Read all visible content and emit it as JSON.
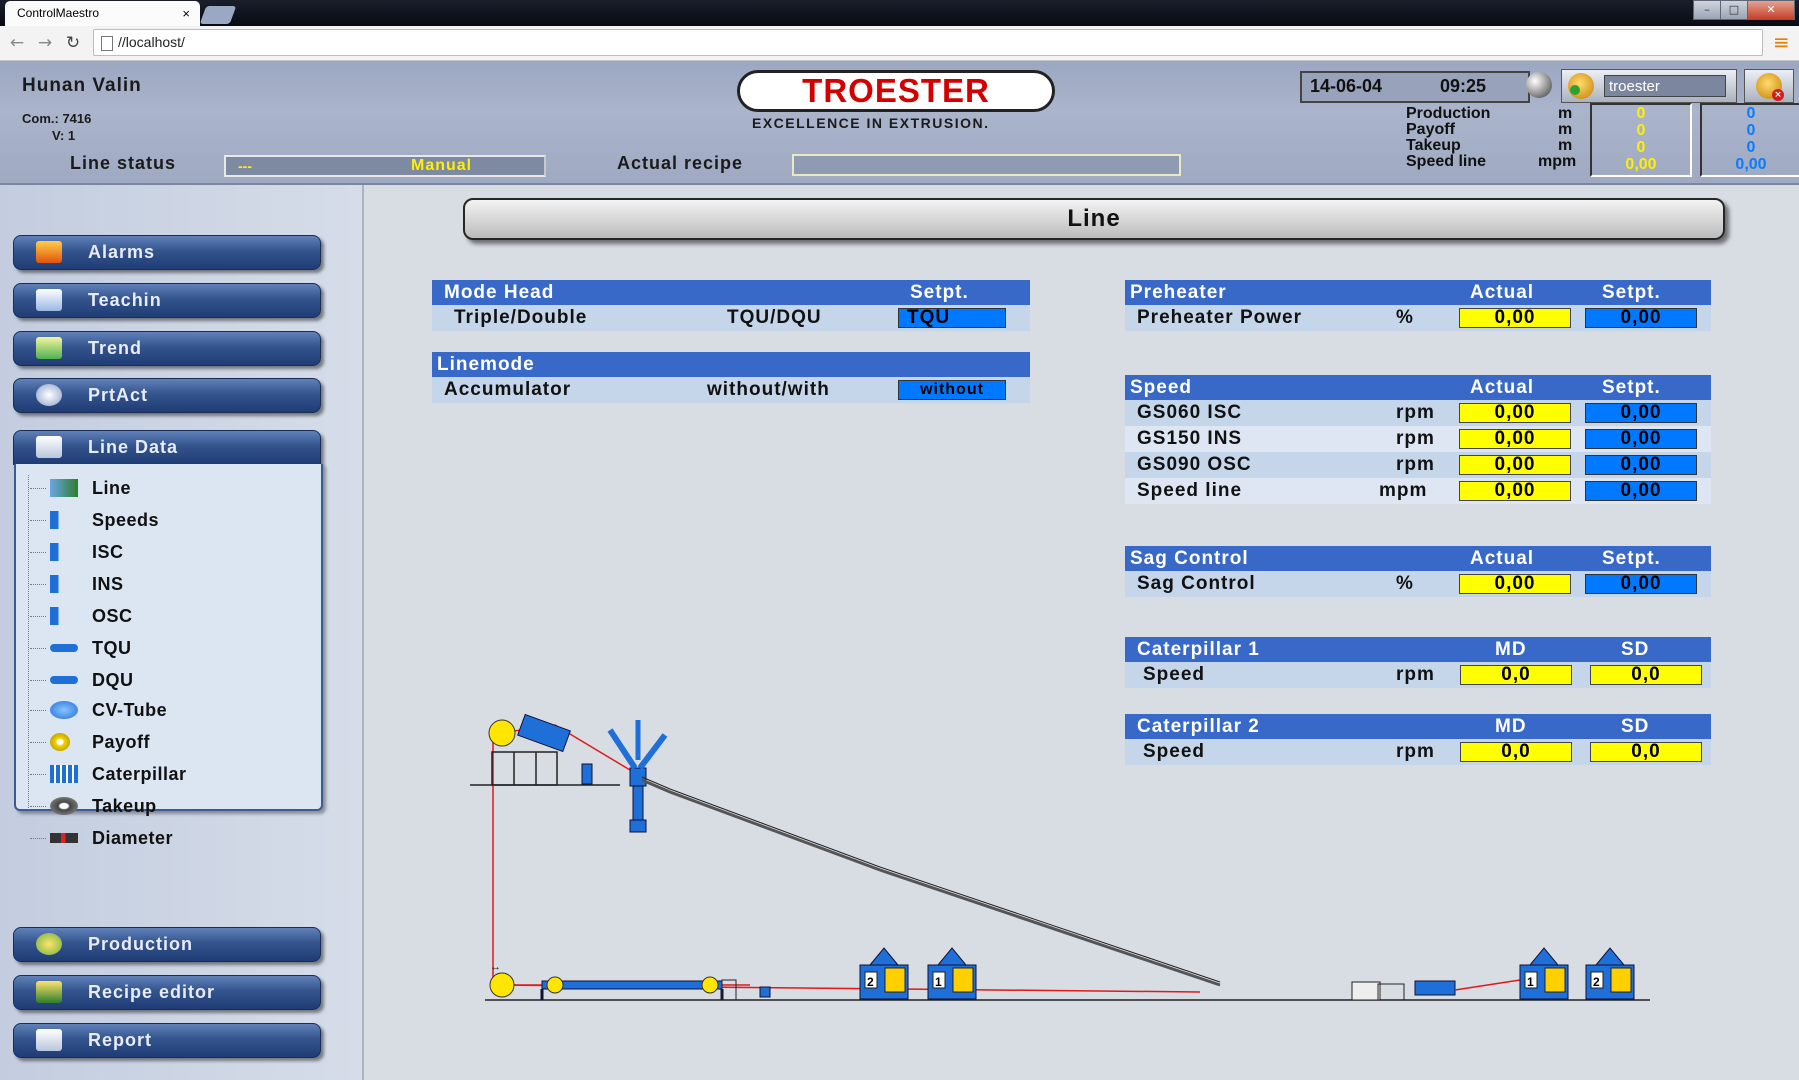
{
  "browser": {
    "tab_title": "ControlMaestro",
    "tab_close": "×",
    "url": "//localhost/"
  },
  "header": {
    "company": "Hunan Valin",
    "com": "Com.: 7416",
    "version": "V: 1",
    "line_status_label": "Line status",
    "line_status_dash": "---",
    "line_status_value": "Manual",
    "actual_recipe_label": "Actual recipe",
    "actual_recipe_value": "",
    "logo": "TROESTER",
    "slogan": "EXCELLENCE IN EXTRUSION.",
    "date": "14-06-04",
    "time": "09:25",
    "user": "troester",
    "stats": [
      {
        "label": "Production",
        "unit": "m",
        "v1": "0",
        "v2": "0"
      },
      {
        "label": "Payoff",
        "unit": "m",
        "v1": "0",
        "v2": "0"
      },
      {
        "label": "Takeup",
        "unit": "m",
        "v1": "0",
        "v2": "0"
      },
      {
        "label": "Speed line",
        "unit": "mpm",
        "v1": "0,00",
        "v2": "0,00"
      }
    ]
  },
  "sidebar": {
    "buttons_top": [
      "Alarms",
      "Teachin",
      "Trend",
      "PrtAct"
    ],
    "line_data": "Line Data",
    "tree": [
      "Line",
      "Speeds",
      "ISC",
      "INS",
      "OSC",
      "TQU",
      "DQU",
      "CV-Tube",
      "Payoff",
      "Caterpillar",
      "Takeup",
      "Diameter"
    ],
    "buttons_bottom": [
      "Production",
      "Recipe editor",
      "Report"
    ]
  },
  "main": {
    "title": "Line",
    "mode_head": {
      "header": "Mode Head",
      "setpt": "Setpt.",
      "row_label": "Triple/Double",
      "row_options": "TQU/DQU",
      "row_value": "TQU"
    },
    "linemode": {
      "header": "Linemode",
      "row_label": "Accumulator",
      "row_options": "without/with",
      "row_value": "without"
    },
    "preheater": {
      "header": "Preheater",
      "actual": "Actual",
      "setpt": "Setpt.",
      "rows": [
        {
          "label": "Preheater Power",
          "unit": "%",
          "actual": "0,00",
          "setpt": "0,00"
        }
      ]
    },
    "speed": {
      "header": "Speed",
      "actual": "Actual",
      "setpt": "Setpt.",
      "rows": [
        {
          "label": "GS060 ISC",
          "unit": "rpm",
          "actual": "0,00",
          "setpt": "0,00"
        },
        {
          "label": "GS150 INS",
          "unit": "rpm",
          "actual": "0,00",
          "setpt": "0,00"
        },
        {
          "label": "GS090 OSC",
          "unit": "rpm",
          "actual": "0,00",
          "setpt": "0,00"
        },
        {
          "label": "Speed line",
          "unit": "mpm",
          "actual": "0,00",
          "setpt": "0,00"
        }
      ]
    },
    "sag": {
      "header": "Sag Control",
      "actual": "Actual",
      "setpt": "Setpt.",
      "rows": [
        {
          "label": "Sag Control",
          "unit": "%",
          "actual": "0,00",
          "setpt": "0,00"
        }
      ]
    },
    "cat1": {
      "header": "Caterpillar 1",
      "md": "MD",
      "sd": "SD",
      "rows": [
        {
          "label": "Speed",
          "unit": "rpm",
          "md": "0,0",
          "sd": "0,0"
        }
      ]
    },
    "cat2": {
      "header": "Caterpillar 2",
      "md": "MD",
      "sd": "SD",
      "rows": [
        {
          "label": "Speed",
          "unit": "rpm",
          "md": "0,0",
          "sd": "0,0"
        }
      ]
    },
    "diagram": {
      "unit_labels": [
        "2",
        "1",
        "1",
        "2"
      ]
    }
  },
  "colors": {
    "panel_header": "#3868c8",
    "actual_value": "#ffff00",
    "setpoint_value": "#0078ff",
    "nav_button": "#34548e",
    "brand_red": "#d40000"
  }
}
